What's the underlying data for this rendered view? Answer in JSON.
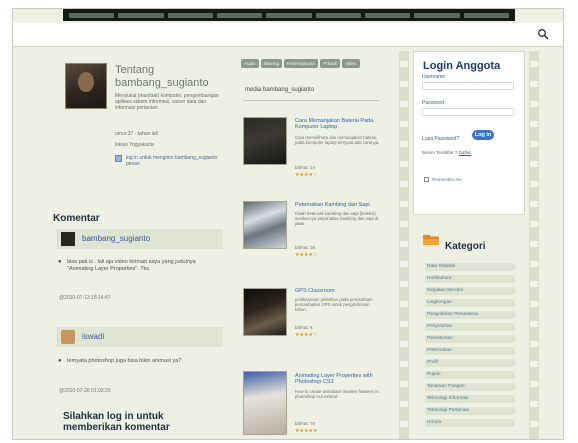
{
  "top_nav": {
    "items": [
      "",
      "",
      "",
      "",
      "",
      "",
      "",
      "",
      ""
    ]
  },
  "search": {
    "icon": "search-icon"
  },
  "about": {
    "title": "Tentang bambang_sugianto",
    "desc": "Menyukai (manfaat) komputer, pengembangan aplikasi sistem informasi, susun data dan informasi pertanian.",
    "umur": "umur 37 - tahun lah",
    "lokasi": "lokasi Yogyakarta",
    "login_link": "log in untuk mengirim bambang_sugianto pesan"
  },
  "comments": {
    "title": "Komentar",
    "items": [
      {
        "name": "bambang_sugianto",
        "text": "bisa pak is . lali aja video kiriman saya yang judulnya \"Animating Layer Properties\". Tks",
        "date": "@2010-07-13 15:14:47"
      },
      {
        "name": "iswadi",
        "text": "ternyata photoshop juga bisa bikin animasi ya?",
        "date": "@2010-07-28 01:03:23"
      }
    ],
    "login_note": "Silahkan log in untuk memberikan komentar"
  },
  "media": {
    "tabs": [
      "Audio",
      "Sharing",
      "Kebersamaan",
      "Pribadi",
      "Video"
    ],
    "title": "media bambang_sugianto",
    "items": [
      {
        "title": "Cara Memanjakan Baterai Pada Komputer Laptop",
        "desc": "Cara memelihara dan memanjakan baterai pada komputer laptop ternyata ada caranya.",
        "views": "Dilihat: 14",
        "rating": 4
      },
      {
        "title": "Peternakan Kambing dan Sapi",
        "desc": "Kisah beternak kambing dan sapi (koleksi) sumbernya peternakan kambing dan sapi di jawa.",
        "views": "Dilihat: 38",
        "rating": 4
      },
      {
        "title": "GPS Classroom",
        "desc": "pelaksanaan pelatihan pada perusahaan pemanfaatan GPS untuk penginderaan tahun.",
        "views": "Dilihat: 8",
        "rating": 4
      },
      {
        "title": "Animating Layer Properties with Photoshop CS3",
        "desc": "How to create animation timeline features in photoshop cs3 extend",
        "views": "Dilihat: 70",
        "rating": 5
      }
    ]
  },
  "login": {
    "title": "Login Anggota",
    "username_label": "Username",
    "password_label": "Password",
    "forgot_label": "Lupa Password?",
    "button_label": "Log in",
    "register_prefix": "Belum Terdaftar ?",
    "register_link": "Daftar",
    "remember_label": "Remember me"
  },
  "kategori": {
    "title": "Kategori",
    "items": [
      "Data Statistik",
      "Hortikultura",
      "Kegiatan Menteri",
      "Lingkungan",
      "Pengolahan Pemasaran",
      "Penyuluhan",
      "Perkebunan",
      "Peternakan",
      "Profil",
      "Pupuk",
      "Tanaman Pangan",
      "Teknologi Informasi",
      "Teknologi Pertanian",
      "Umum"
    ]
  },
  "colors": {
    "nav_dark": "#151a14",
    "accent_blue": "#2f64ad",
    "star_gold": "#d49b0a",
    "button_blue": "#3b73c6",
    "background": "#eef0e3"
  }
}
